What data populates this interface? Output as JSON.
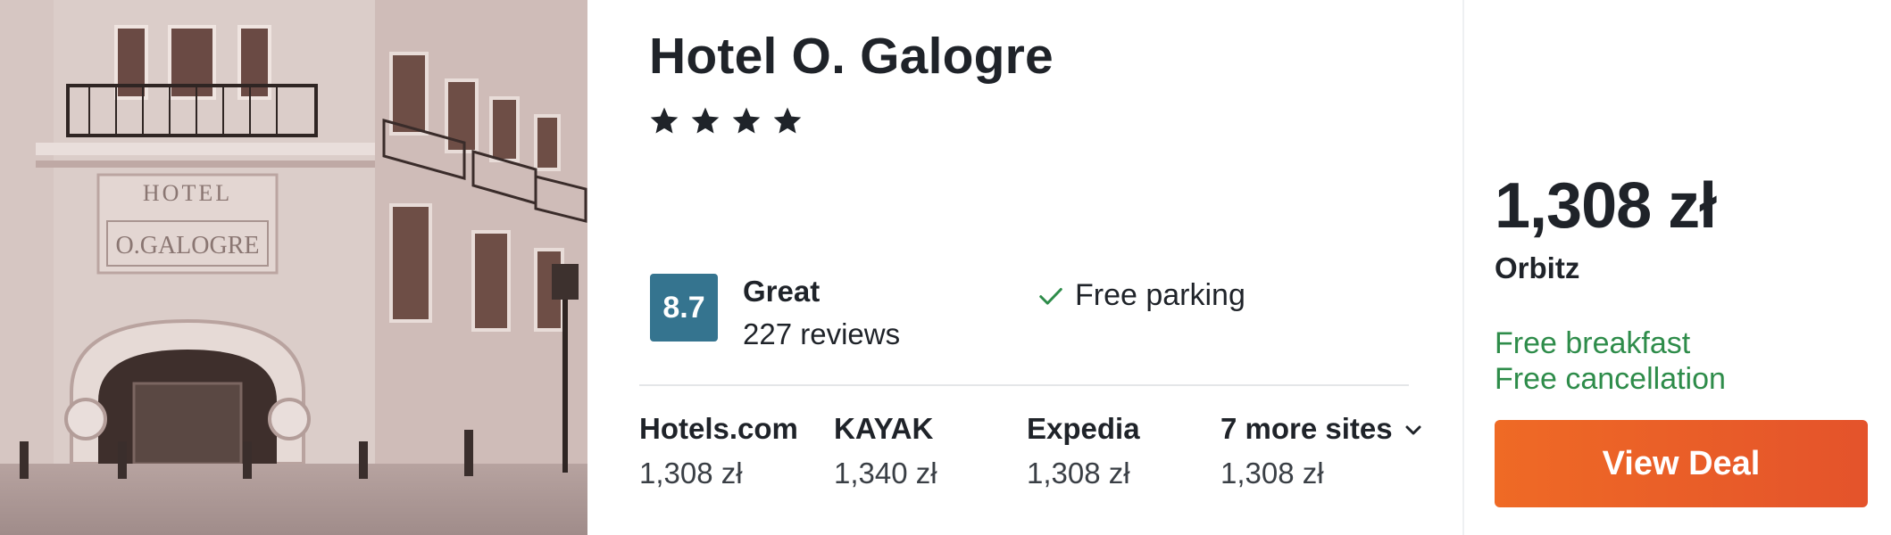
{
  "hotel": {
    "name": "Hotel O. Galogre",
    "star_count": 4,
    "photo_sign_line1": "HOTEL",
    "photo_sign_line2": "O.GALOGRE"
  },
  "rating": {
    "score": "8.7",
    "label": "Great",
    "reviews": "227 reviews",
    "badge_color": "#35748f"
  },
  "amenities": [
    {
      "label": "Free parking",
      "icon": "checkmark-icon"
    }
  ],
  "providers": [
    {
      "name": "Hotels.com",
      "price": "1,308 zł"
    },
    {
      "name": "KAYAK",
      "price": "1,340 zł"
    },
    {
      "name": "Expedia",
      "price": "1,308 zł"
    },
    {
      "name": "7 more sites",
      "price": "1,308 zł",
      "icon": "chevron-down-icon"
    }
  ],
  "deal": {
    "price": "1,308 zł",
    "seller": "Orbitz",
    "perks": [
      "Free breakfast",
      "Free cancellation"
    ],
    "button_label": "View Deal",
    "perk_color": "#2e8c4a",
    "button_color": "#ea5f28"
  }
}
